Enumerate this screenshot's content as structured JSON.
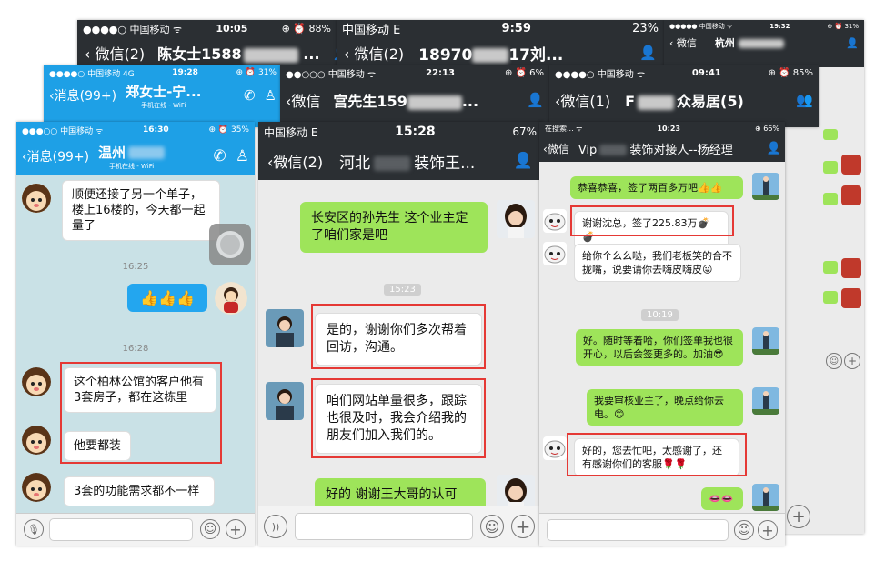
{
  "phones": {
    "p_top1": {
      "carrier": "●●●●○ 中国移动 ᯤ",
      "time": "10:05",
      "battery": "⊕ ⏰ 88%",
      "back": "微信(2)",
      "title": "陈女士1588",
      "suffix": "..."
    },
    "p_top2": {
      "carrier": "中国移动 E",
      "time": "9:59",
      "battery": "23%",
      "back": "微信(2)",
      "title": "18970",
      "suffix": "17刘..."
    },
    "p_top3": {
      "carrier": "●●●●● 中国移动 ᯤ",
      "time": "19:32",
      "battery": "⊕ ⏰ 31%",
      "back": "微信",
      "title": "杭州"
    },
    "p_mid1": {
      "carrier": "●●●●○ 中国移动 4G",
      "time": "19:28",
      "battery": "⊕ ⏰ 31%",
      "back": "消息(99+)",
      "title": "郑女士-宁...",
      "subtitle": "手机在线 - WiFi"
    },
    "p_mid2": {
      "carrier": "●●○○○ 中国移动 ᯤ",
      "time": "22:13",
      "battery": "⊕ ⏰ 6%",
      "back": "微信",
      "title": "宫先生159",
      "suffix": "..."
    },
    "p_mid3": {
      "carrier": "●●●●○ 中国移动 ᯤ",
      "time": "09:41",
      "battery": "⊕ ⏰ 85%",
      "back": "微信(1)",
      "title": "众易居(5)"
    },
    "p_a": {
      "carrier": "●●●○○ 中国移动 ᯤ",
      "time": "16:30",
      "battery": "⊕ ⏰ 35%",
      "back": "消息(99+)",
      "title": "温州",
      "subtitle": "手机在线 - WiFi",
      "msg1": "顺便还接了另一个单子，楼上16楼的，今天都一起量了",
      "ts1": "16:25",
      "emoji": "👍👍👍",
      "ts2": "16:28",
      "msg2": "这个柏林公馆的客户他有3套房子，都在这栋里",
      "msg3": "他要都装",
      "msg4": "3套的功能需求都不一样"
    },
    "p_b": {
      "carrier": "中国移动 E",
      "time": "15:28",
      "battery": "67%",
      "back": "微信(2)",
      "title": "河北",
      "title2": "装饰王...",
      "msg1": "长安区的孙先生 这个业主定了咱们家是吧",
      "ts": "15:23",
      "msg2": "是的，谢谢你们多次帮着回访，沟通。",
      "msg3": "咱们网站单量很多，跟踪也很及时，我会介绍我的朋友们加入我们的。",
      "msg4": "好的 谢谢王大哥的认可"
    },
    "p_c": {
      "carrier": "在搜索... ᯤ",
      "time": "10:23",
      "battery": "⊕ 66%",
      "back": "微信",
      "title": "Vip",
      "title2": "装饰对接人--杨经理",
      "msg1": "恭喜恭喜，签了两百多万吧👍👍",
      "msg2": "谢谢沈总，签了225.83万💣💣",
      "msg3": "给你个么么哒，我们老板笑的合不拢嘴，说要请你去嗨皮嗨皮😜",
      "ts": "10:19",
      "msg4": "好。随时等着哈，你们签单我也很开心，以后会签更多的。加油😎",
      "msg5": "我要审核业主了，晚点给你去电。😊",
      "msg6": "好的，您去忙吧，太感谢了，还有感谢你们的客服🌹🌹",
      "msg7": "👄👄"
    }
  },
  "colors": {
    "wechat_dark": "#2b2f33",
    "qq_blue": "#1ea0e6",
    "qq_bg": "#c9e1e6",
    "wechat_bg": "#ebebeb",
    "highlight": "#e53935"
  }
}
